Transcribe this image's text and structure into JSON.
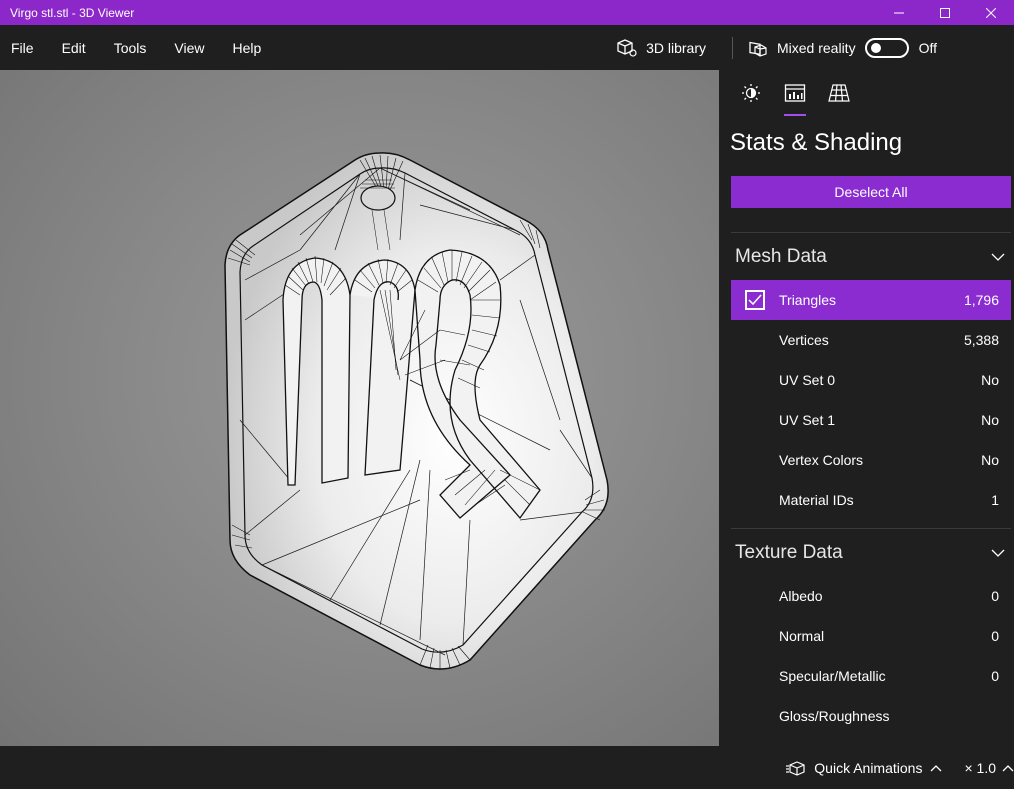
{
  "window": {
    "title": "Virgo stl.stl - 3D Viewer",
    "accent": "#8c28c9"
  },
  "menu": {
    "items": [
      "File",
      "Edit",
      "Tools",
      "View",
      "Help"
    ]
  },
  "toolbar": {
    "library_label": "3D library",
    "mixed_reality_label": "Mixed reality",
    "toggle_state": "Off"
  },
  "panel": {
    "title": "Stats & Shading",
    "deselect_label": "Deselect All",
    "tabs": [
      "lighting-icon",
      "stats-icon",
      "grid-icon"
    ],
    "mesh": {
      "header": "Mesh Data",
      "rows": [
        {
          "label": "Triangles",
          "value": "1,796",
          "selected": true
        },
        {
          "label": "Vertices",
          "value": "5,388"
        },
        {
          "label": "UV Set 0",
          "value": "No"
        },
        {
          "label": "UV Set 1",
          "value": "No"
        },
        {
          "label": "Vertex Colors",
          "value": "No"
        },
        {
          "label": "Material IDs",
          "value": "1"
        }
      ]
    },
    "texture": {
      "header": "Texture Data",
      "rows": [
        {
          "label": "Albedo",
          "value": "0"
        },
        {
          "label": "Normal",
          "value": "0"
        },
        {
          "label": "Specular/Metallic",
          "value": "0"
        },
        {
          "label": "Gloss/Roughness",
          "value": ""
        }
      ]
    }
  },
  "bottom": {
    "animations_label": "Quick Animations",
    "speed_label": "× 1.0"
  }
}
